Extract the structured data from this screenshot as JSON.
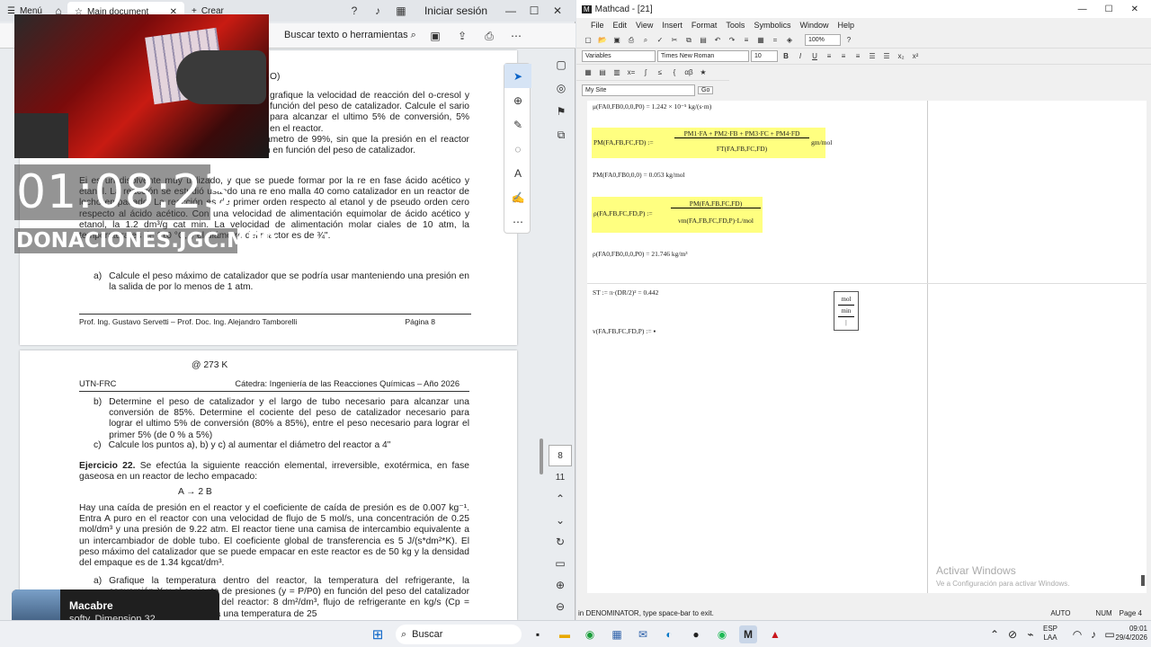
{
  "pdf": {
    "tabs": {
      "menu": "Menú",
      "doc": "Main document",
      "new": "Crear"
    },
    "topbar": {
      "login": "Iniciar sesión"
    },
    "toolbar": {
      "search": "Buscar texto o herramientas"
    },
    "page1": {
      "line_o": "O)",
      "para1": "grafique la velocidad de reacción del o-cresol y función del peso de catalizador. Calcule el sario para alcanzar el ultimo 5% de conversión, 5% en el reactor.",
      "para2": "presión en el lecho, seleccione un diámetro de 99%, sin que la presión en el reactor sea menor a 1 atm. Grafique la presión en función del peso de catalizador.",
      "para3": "Ej   es un disolvente muy utilizado, y que se puede formar por la re   en fase   ácido acético y etanol. La reacción se estudió usando una re   eno malla 40 como catalizador en un reactor de lecho empacado. La reacción es de primer orden respecto al etanol y de pseudo orden cero respecto al ácido acético. Con una velocidad de alimentación equimolar de ácido acético y etanol, la   1.2 dm³/g cat min. La velocidad de alimentación molar   ciales de 10 atm, la temperatura es de 110 °C, y el diámetro del reactor es de ¾\".",
      "item_a": "Calcule el peso máximo de catalizador que se podría usar manteniendo una presión en la salida de por lo menos de 1 atm.",
      "footer_left": "Prof. Ing. Gustavo Servetti – Prof. Doc. Ing. Alejandro Tamborelli",
      "footer_right": "Página 8"
    },
    "page2": {
      "at": "@ 273 K",
      "hdr_left": "UTN-FRC",
      "hdr_right": "Cátedra: Ingeniería de las Reacciones Químicas – Año 2026",
      "item_b": "Determine el peso de catalizador y el largo de tubo necesario para alcanzar una conversión de 85%. Determine el cociente del peso de catalizador necesario para lograr el ultimo 5% de conversión (80% a 85%), entre el peso necesario para lograr el primer 5% (de 0 % a 5%)",
      "item_c": "Calcule los puntos a), b) y c) al aumentar el diámetro del reactor a 4\"",
      "ex22_title": "Ejercicio 22.",
      "ex22_text": "Se efectúa la siguiente reacción elemental, irreversible, exotérmica, en fase gaseosa en un reactor de lecho empacado:",
      "reaction": "A → 2 B",
      "para_main": "Hay una caída de presión en el reactor y el coeficiente de caída de presión es de 0.007 kg⁻¹. Entra A puro en el reactor con una velocidad de flujo de 5 mol/s, una concentración de 0.25 mol/dm³ y una presión de 9.22 atm. El reactor tiene una camisa de intercambio equivalente a un intercambiador de doble tubo. El coeficiente global de transferencia es 5 J/(s*dm²*K). El peso máximo del catalizador que se puede empacar en este reactor es de 50 kg y la densidad del empaque es de 1.34 kgcat/dm³.",
      "item_a2": "Grafique la temperatura dentro del reactor, la temperatura del refrigerante, la conversión X y el cociente de presiones (y = P/P0) en función del peso del catalizador para un área de    volumen del reactor: 8 dm²/dm³, flujo de refrigerante en    kg/s (Cp = 2470 J/kg*K), ingresando a una temperatura de 25"
    },
    "nav": {
      "page_num": "8",
      "page_total": "11"
    }
  },
  "overlay": {
    "time": "01:08:23",
    "donation": "DONACIONES.JGC.MP9"
  },
  "mathcad": {
    "title": "Mathcad - [21]",
    "menu": [
      "File",
      "Edit",
      "View",
      "Insert",
      "Format",
      "Tools",
      "Symbolics",
      "Window",
      "Help"
    ],
    "zoom": "100%",
    "style": "Variables",
    "font": "Times New Roman",
    "size": "10",
    "site": "My Site",
    "go": "Go",
    "eq_top": "μ(FA0,FB0,0,0,P0) = 1.242 × 10⁻⁵ kg/(s·m)",
    "eq_pm_lhs": "PM(FA,FB,FC,FD) :=",
    "eq_pm_num": "PM1·FA + PM2·FB + PM3·FC + PM4·FD",
    "eq_pm_den": "FT(FA,FB,FC,FD)",
    "eq_pm_unit": "gm/mol",
    "eq_pm0": "PM(FA0,FB0,0,0) = 0.053 kg/mol",
    "eq_rho_lhs": "ρ(FA,FB,FC,FD,P) :=",
    "eq_rho_num": "PM(FA,FB,FC,FD)",
    "eq_rho_den": "vm(FA,FB,FC,FD,P)·L/mol",
    "eq_rho0": "ρ(FA0,FB0,0,0,P0) = 21.746 kg/m³",
    "eq_st": "ST := π·(DR/2)² = 0.442",
    "unit_box": [
      "mol",
      "min",
      "|"
    ],
    "eq_v": "v(FA,FB,FC,FD,P) := ▪",
    "watermark_title": "Activar Windows",
    "watermark_sub": "Ve a Configuración para activar Windows.",
    "status_left": "in DENOMINATOR, type space-bar to exit.",
    "status_auto": "AUTO",
    "status_num": "NUM",
    "status_page": "Page 4"
  },
  "notification": {
    "title": "Macabre",
    "subtitle": "softy, Dimension 32"
  },
  "taskbar": {
    "search": "Buscar",
    "lang1": "ESP",
    "lang2": "LAA",
    "time": "09:01",
    "date": "29/4/2026"
  },
  "colors": {
    "accent": "#0a64c8",
    "highlight": "#ffff80"
  }
}
